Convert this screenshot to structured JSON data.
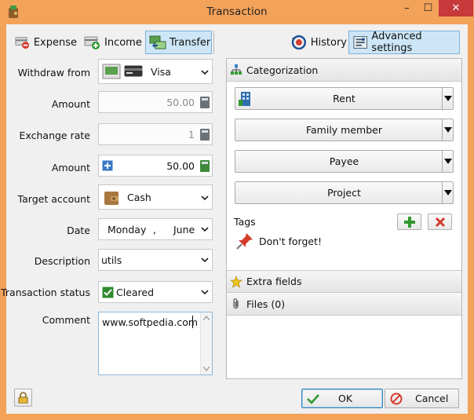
{
  "window": {
    "title": "Transaction",
    "minimize": "–",
    "maximize": "☐",
    "close": "✕"
  },
  "tabs": {
    "expense": "Expense",
    "income": "Income",
    "transfer": "Transfer",
    "history": "History",
    "advanced": "Advanced settings"
  },
  "form": {
    "withdraw_from_label": "Withdraw from",
    "withdraw_from_value": "Visa",
    "amount_label": "Amount",
    "amount_value": "50.00",
    "exchange_rate_label": "Exchange rate",
    "exchange_rate_value": "1",
    "amount2_label": "Amount",
    "amount2_value": "50.00",
    "target_account_label": "Target account",
    "target_account_value": "Cash",
    "date_label": "Date",
    "date_day": "Monday",
    "date_sep": ",",
    "date_month": "June",
    "description_label": "Description",
    "description_value": "utils",
    "status_label": "Transaction status",
    "status_value": "Cleared",
    "comment_label": "Comment",
    "comment_value": "www.softpedia.com"
  },
  "categorization": {
    "header": "Categorization",
    "category": "Rent",
    "family_member": "Family member",
    "payee": "Payee",
    "project": "Project",
    "tags_label": "Tags",
    "tag": "Don't forget!"
  },
  "sections": {
    "extra_fields": "Extra fields",
    "files": "Files (0)"
  },
  "buttons": {
    "ok": "OK",
    "cancel": "Cancel"
  },
  "icons": {
    "app": "wallet-icon",
    "expense": "card-minus-icon",
    "income": "card-plus-icon",
    "transfer": "transfer-icon",
    "history": "history-icon",
    "advanced": "settings-icon",
    "calculator": "calculator-icon",
    "tag": "pushpin-icon",
    "lock": "lock-icon"
  },
  "colors": {
    "titlebar": "#f3a259",
    "close": "#c7393a",
    "active_tab": "#cde6f7",
    "ok_border": "#3c7fb1",
    "add_green": "#2f9a2f",
    "delete_red": "#d33c2c"
  }
}
